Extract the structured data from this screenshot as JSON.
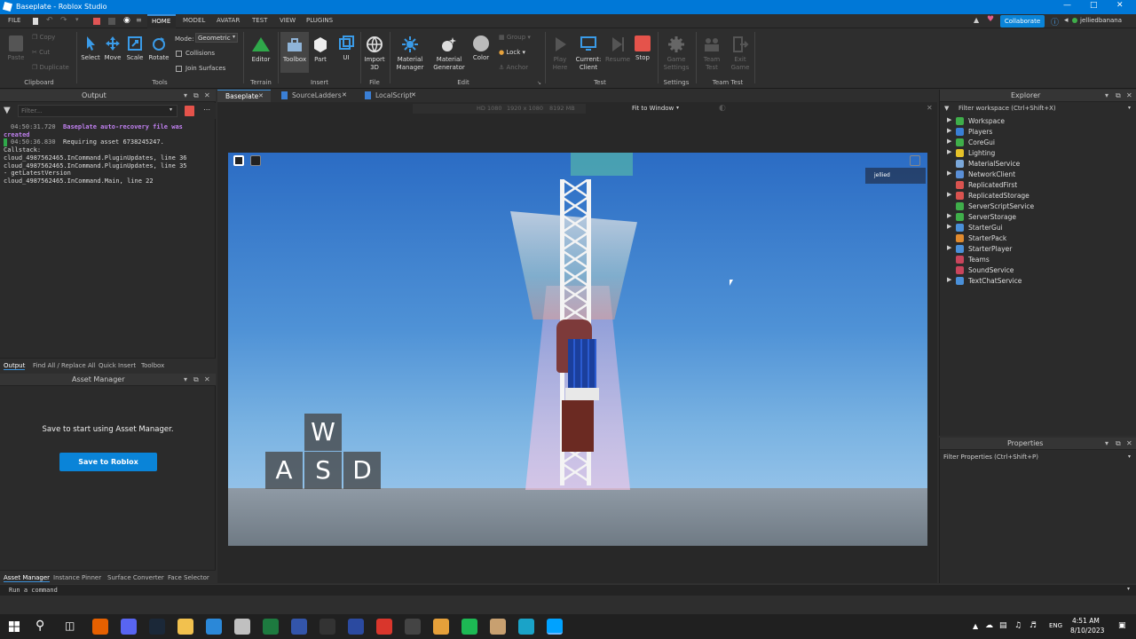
{
  "window": {
    "title": "Baseplate - Roblox Studio"
  },
  "menu": {
    "file": "FILE",
    "tabs": [
      "HOME",
      "MODEL",
      "AVATAR",
      "TEST",
      "VIEW",
      "PLUGINS"
    ],
    "collaborate": "Collaborate",
    "user": "jelliedbanana"
  },
  "ribbon": {
    "clipboard": {
      "paste": "Paste",
      "copy": "Copy",
      "cut": "Cut",
      "duplicate": "Duplicate",
      "group": "Clipboard"
    },
    "tools": {
      "select": "Select",
      "move": "Move",
      "scale": "Scale",
      "rotate": "Rotate",
      "mode_label": "Mode:",
      "mode_value": "Geometric",
      "collisions": "Collisions",
      "join_surfaces": "Join Surfaces",
      "group": "Tools"
    },
    "terrain": {
      "editor": "Editor",
      "group": "Terrain"
    },
    "insert": {
      "toolbox": "Toolbox",
      "part": "Part",
      "ui": "UI",
      "group": "Insert"
    },
    "file": {
      "import": "Import",
      "import2": "3D",
      "group": "File"
    },
    "edit": {
      "material_manager": "Material",
      "material_manager2": "Manager",
      "material_generator": "Material",
      "material_generator2": "Generator",
      "color": "Color",
      "group_btn": "Group",
      "lock": "Lock",
      "anchor": "Anchor",
      "group": "Edit"
    },
    "test": {
      "play": "Play",
      "play2": "Here",
      "current_client": "Current:",
      "current_client2": "Client",
      "resume": "Resume",
      "stop": "Stop",
      "group": "Test"
    },
    "settings": {
      "game_settings": "Game",
      "game_settings2": "Settings",
      "group": "Settings"
    },
    "team_test": {
      "team_test": "Team",
      "team_test2": "Test",
      "exit_game": "Exit",
      "exit_game2": "Game",
      "group": "Team Test"
    }
  },
  "output": {
    "title": "Output",
    "filter_placeholder": "Filter...",
    "lines": [
      {
        "time": "04:50:31.720",
        "text": "Baseplate auto-recovery file was"
      },
      {
        "time": "",
        "text": "created"
      },
      {
        "time": "04:50:36.830",
        "text": "Requiring asset 6738245247."
      },
      {
        "time": "",
        "text": "Callstack:"
      },
      {
        "time": "",
        "text": "cloud_4987562465.InCommand.PluginUpdates, line 36"
      },
      {
        "time": "",
        "text": "cloud_4987562465.InCommand.PluginUpdates, line 35"
      },
      {
        "time": "",
        "text": "- getLatestVersion"
      },
      {
        "time": "",
        "text": "cloud_4987562465.InCommand.Main, line 22"
      }
    ],
    "tabs": [
      "Output",
      "Find All / Replace All",
      "Quick Insert",
      "Toolbox"
    ]
  },
  "asset_manager": {
    "title": "Asset Manager",
    "message": "Save to start using Asset Manager.",
    "button": "Save to Roblox",
    "tabs": [
      "Asset Manager",
      "Instance Pinner",
      "Surface Converter",
      "Face Selector"
    ]
  },
  "doc_tabs": [
    "Baseplate",
    "SourceLadders",
    "LocalScript"
  ],
  "viewport": {
    "res_label": "HD 1080",
    "res_value": "1920 x 1080",
    "mem": "8192 MB",
    "fit": "Fit to Window",
    "player_tag": "jellied",
    "keys": {
      "w": "W",
      "a": "A",
      "s": "S",
      "d": "D"
    }
  },
  "explorer": {
    "title": "Explorer",
    "filter": "Filter workspace (Ctrl+Shift+X)",
    "items": [
      {
        "name": "Workspace",
        "color": "#3fae4a",
        "arrow": true
      },
      {
        "name": "Players",
        "color": "#3a7fd5",
        "arrow": true
      },
      {
        "name": "CoreGui",
        "color": "#3fae4a",
        "arrow": true
      },
      {
        "name": "Lighting",
        "color": "#e6c229",
        "arrow": true
      },
      {
        "name": "MaterialService",
        "color": "#7aa7d9",
        "arrow": false
      },
      {
        "name": "NetworkClient",
        "color": "#5a8fd6",
        "arrow": true
      },
      {
        "name": "ReplicatedFirst",
        "color": "#d9534f",
        "arrow": false
      },
      {
        "name": "ReplicatedStorage",
        "color": "#d9534f",
        "arrow": true
      },
      {
        "name": "ServerScriptService",
        "color": "#3fae4a",
        "arrow": false
      },
      {
        "name": "ServerStorage",
        "color": "#3fae4a",
        "arrow": true
      },
      {
        "name": "StarterGui",
        "color": "#4a90d9",
        "arrow": true
      },
      {
        "name": "StarterPack",
        "color": "#e08a2e",
        "arrow": false
      },
      {
        "name": "StarterPlayer",
        "color": "#4a90d9",
        "arrow": true
      },
      {
        "name": "Teams",
        "color": "#c9455c",
        "arrow": false
      },
      {
        "name": "SoundService",
        "color": "#c9455c",
        "arrow": false
      },
      {
        "name": "TextChatService",
        "color": "#4a90d9",
        "arrow": true
      }
    ]
  },
  "properties": {
    "title": "Properties",
    "filter": "Filter Properties (Ctrl+Shift+P)"
  },
  "command_bar": {
    "placeholder": "Run a command"
  },
  "taskbar": {
    "time": "4:51 AM",
    "date": "8/10/2023",
    "lang": "ENG",
    "apps": [
      {
        "name": "firefox-icon",
        "color": "#e66000"
      },
      {
        "name": "discord-icon",
        "color": "#5865f2"
      },
      {
        "name": "steam-icon",
        "color": "#1b2838"
      },
      {
        "name": "file-explorer-icon",
        "color": "#f2c14e"
      },
      {
        "name": "snipping-tool-icon",
        "color": "#2b88d8"
      },
      {
        "name": "vs-icon",
        "color": "#c0c0c0"
      },
      {
        "name": "excel-icon",
        "color": "#1d7a3f"
      },
      {
        "name": "visio-icon",
        "color": "#3355aa"
      },
      {
        "name": "app-dark-icon",
        "color": "#333333"
      },
      {
        "name": "brave-icon",
        "color": "#2b4aa0"
      },
      {
        "name": "app-red-icon",
        "color": "#d9362c"
      },
      {
        "name": "minecraft-icon",
        "color": "#444444"
      },
      {
        "name": "app-orange-icon",
        "color": "#e6a03a"
      },
      {
        "name": "spotify-icon",
        "color": "#1db954"
      },
      {
        "name": "app-tan-icon",
        "color": "#c8a070"
      },
      {
        "name": "app-teal-icon",
        "color": "#1aa3c8"
      },
      {
        "name": "roblox-studio-icon",
        "color": "#00a2ff"
      }
    ]
  }
}
